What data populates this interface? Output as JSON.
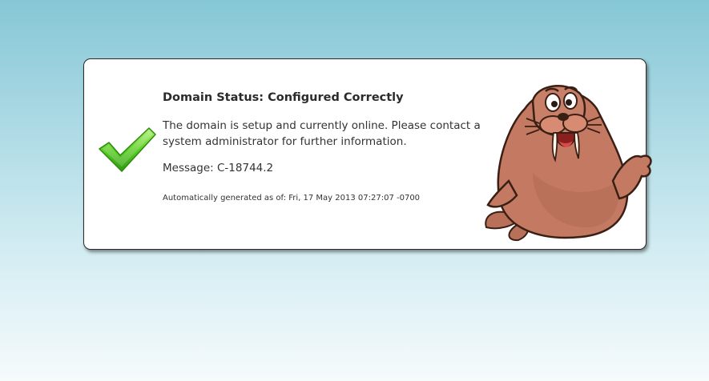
{
  "status": {
    "title": "Domain Status: Configured Correctly",
    "description": "The domain is setup and currently online. Please contact a system administrator for further information.",
    "message": "Message: C-18744.2",
    "generated": "Automatically generated as of: Fri, 17 May 2013 07:27:07 -0700"
  },
  "icons": {
    "status_icon": "checkmark-icon",
    "mascot": "walrus-mascot"
  },
  "colors": {
    "check_green": "#4fc21f",
    "walrus_brown": "#b9705a"
  }
}
